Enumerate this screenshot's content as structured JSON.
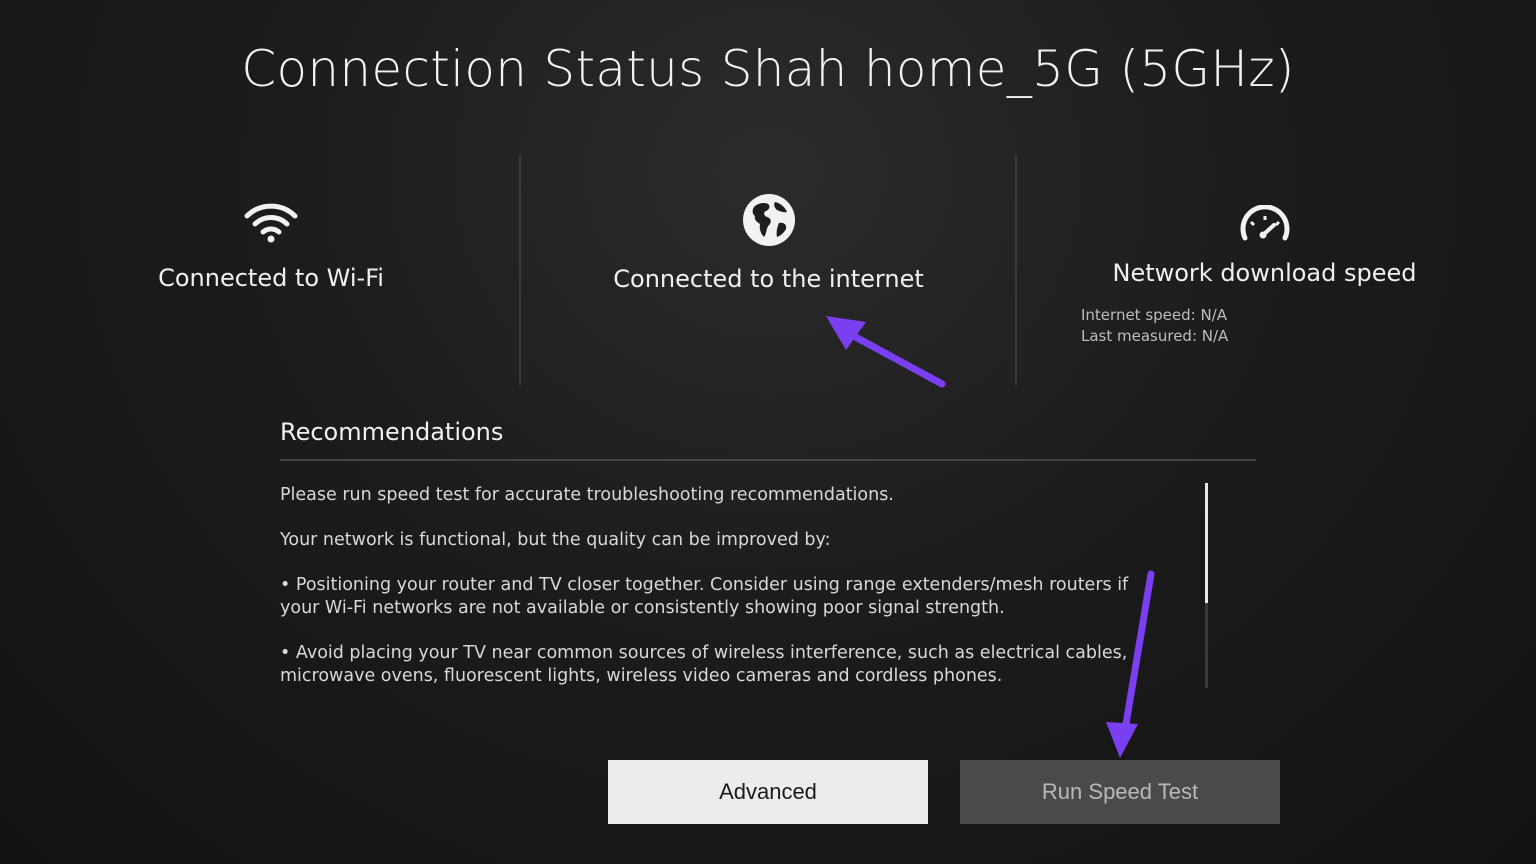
{
  "page": {
    "title": "Connection Status Shah home_5G (5GHz)"
  },
  "status": {
    "wifi": {
      "icon": "wifi-icon",
      "label": "Connected to Wi-Fi"
    },
    "internet": {
      "icon": "globe-icon",
      "label": "Connected to the internet"
    },
    "speed": {
      "icon": "speedometer-icon",
      "label": "Network download speed",
      "internet_speed": "Internet speed: N/A",
      "last_measured": "Last measured: N/A"
    }
  },
  "recommendations": {
    "title": "Recommendations",
    "paragraphs": [
      "Please run speed test for accurate troubleshooting recommendations.",
      "Your network is functional, but the quality can be improved by:",
      "• Positioning your router and TV closer together. Consider using range extenders/mesh routers if your Wi-Fi networks are not available or consistently showing poor signal strength.",
      "• Avoid placing your TV near common sources of wireless interference, such as electrical cables, microwave ovens, fluorescent lights, wireless video cameras and cordless phones."
    ]
  },
  "buttons": {
    "advanced": "Advanced",
    "run_speed_test": "Run Speed Test"
  },
  "colors": {
    "annotation_arrow": "#7b3ff2",
    "focused_button": "#ececec",
    "inactive_button": "#4a4a4a"
  }
}
